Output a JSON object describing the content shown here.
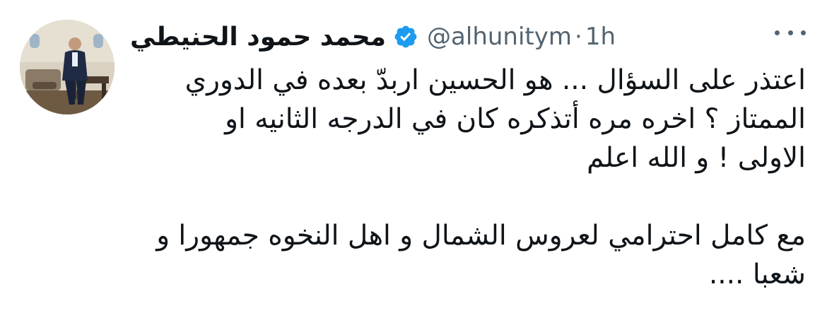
{
  "tweet": {
    "display_name": "محمد حمود الحنيطي",
    "handle": "@alhunitym",
    "separator": "·",
    "time": "1h",
    "verified": true,
    "verified_color": "#1d9bf0",
    "more_icon": "more-horizontal-icon",
    "paragraph_1": "اعتذر على السؤال ... هو الحسين اربدّ بعده في الدوري\nالممتاز ؟ اخره مره أتذكره كان في الدرجه الثانيه او\nالاولى ! و الله اعلم",
    "paragraph_2": "مع كامل احترامي لعروس الشمال و اهل النخوه جمهورا و\nشعبا ...."
  }
}
